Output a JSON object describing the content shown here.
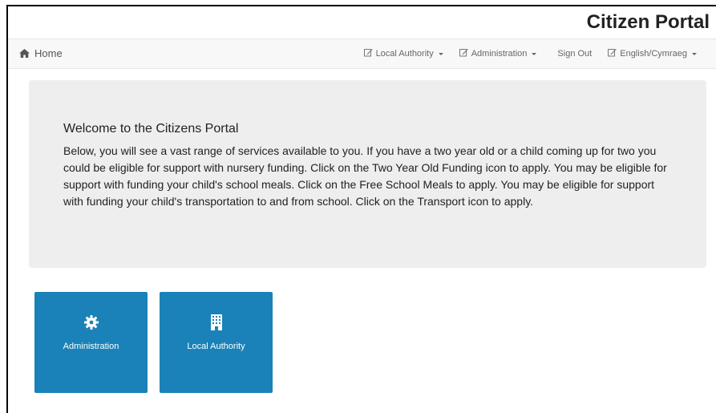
{
  "header": {
    "brand": "Citizen Portal"
  },
  "navbar": {
    "home_label": "Home",
    "items": [
      {
        "label": "Local Authority",
        "icon": "edit-icon",
        "dropdown": true
      },
      {
        "label": "Administration",
        "icon": "edit-icon",
        "dropdown": true
      },
      {
        "label": "Sign Out",
        "icon": null,
        "dropdown": false
      },
      {
        "label": "English/Cymraeg",
        "icon": "edit-icon",
        "dropdown": true
      }
    ]
  },
  "welcome": {
    "title": "Welcome to the Citizens Portal",
    "body": "Below, you will see a vast range of services available to you. If you have a two year old or a child coming up for two you could be eligible for support with nursery funding. Click on the Two Year Old Funding icon to apply. You may be eligible for support with funding your child's school meals. Click on the Free School Meals to apply. You may be eligible for support with funding your child's transportation to and from school. Click on the Transport icon to apply."
  },
  "tiles": [
    {
      "label": "Administration",
      "icon": "gear-icon"
    },
    {
      "label": "Local Authority",
      "icon": "building-icon"
    }
  ],
  "colors": {
    "tile_bg": "#1a82b8",
    "navbar_bg": "#f8f8f8",
    "jumbotron_bg": "#eeeeee"
  }
}
